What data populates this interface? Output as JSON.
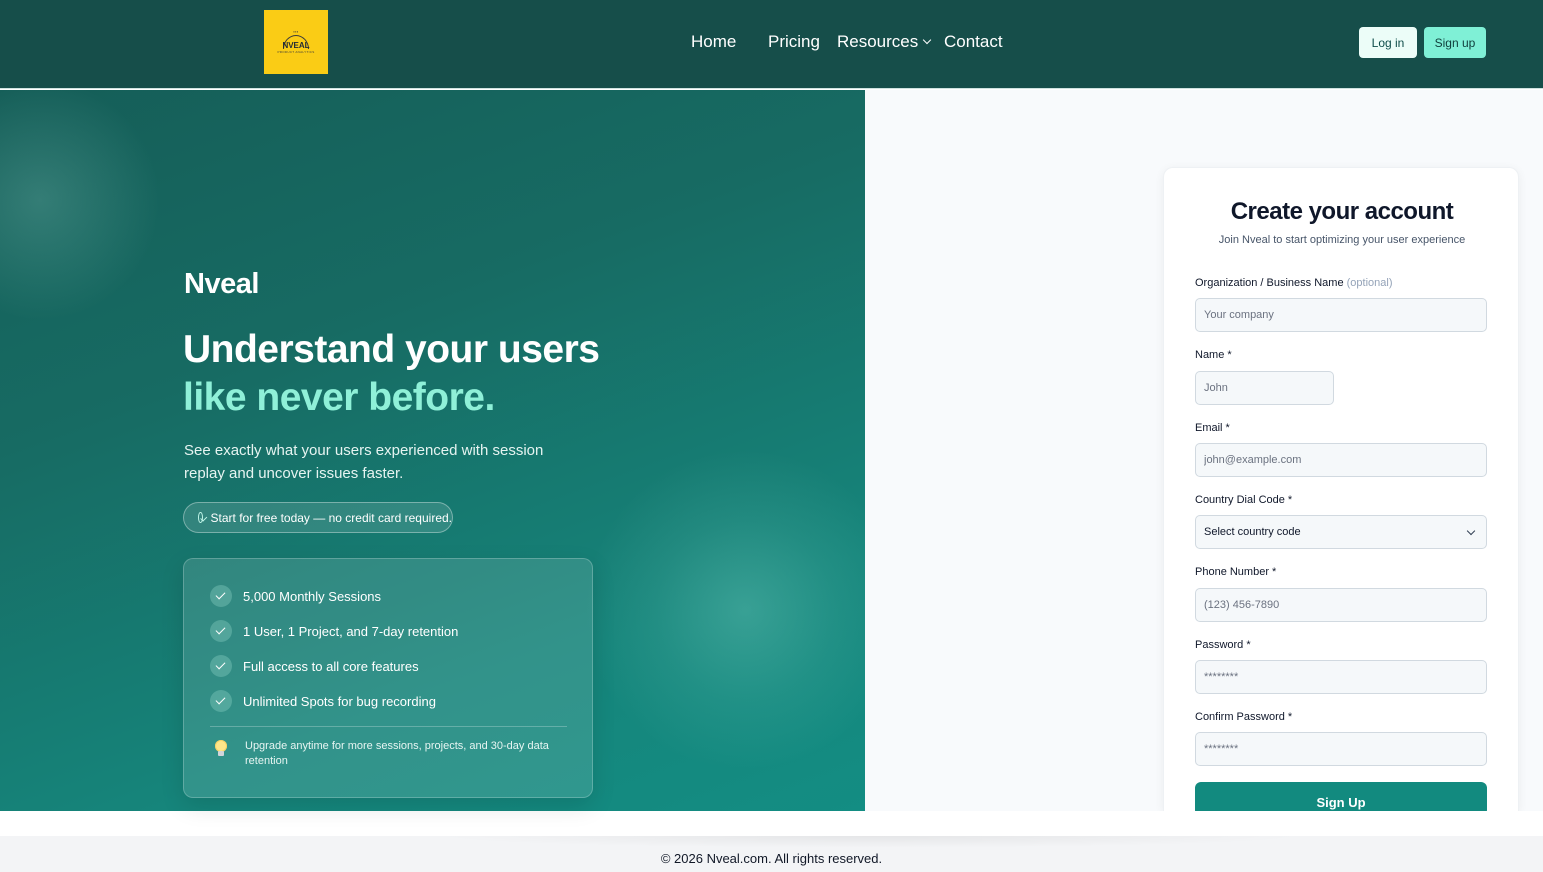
{
  "nav": {
    "logo_text": "NVEAL",
    "logo_tagline": "PRODUCT ANALYTICS",
    "links": [
      "Home",
      "Pricing",
      "Resources",
      "Contact"
    ],
    "login_label": "Log in",
    "signup_label": "Sign up"
  },
  "hero": {
    "brand": "Nveal",
    "headline_line1": "Understand your users",
    "headline_line2": "like never before.",
    "subtitle": "See exactly what your users experienced with session replay and uncover issues faster.",
    "pill_text": "Start for free today — no credit card required.",
    "features": [
      "5,000 Monthly Sessions",
      "1 User, 1 Project, and 7-day retention",
      "Full access to all core features",
      "Unlimited Spots for bug recording"
    ],
    "tip": "Upgrade anytime for more sessions, projects, and 30-day data retention"
  },
  "form": {
    "title": "Create your account",
    "subtitle": "Join Nveal to start optimizing your user experience",
    "org_label": "Organization / Business Name",
    "org_optional": "(optional)",
    "org_placeholder": "Your company",
    "name_label": "Name *",
    "name_placeholder": "John",
    "email_label": "Email *",
    "email_placeholder": "john@example.com",
    "dial_label": "Country Dial Code *",
    "dial_value": "Select country code",
    "phone_label": "Phone Number *",
    "phone_placeholder": "(123) 456-7890",
    "password_label": "Password *",
    "password_placeholder": "********",
    "confirm_label": "Confirm Password *",
    "confirm_placeholder": "********",
    "submit_label": "Sign Up"
  },
  "footer": {
    "copyright": "© 2026 Nveal.com. All rights reserved."
  },
  "colors": {
    "nav_bg": "#164e4a",
    "accent": "#8ff0d8",
    "primary_button": "#128a7f"
  }
}
